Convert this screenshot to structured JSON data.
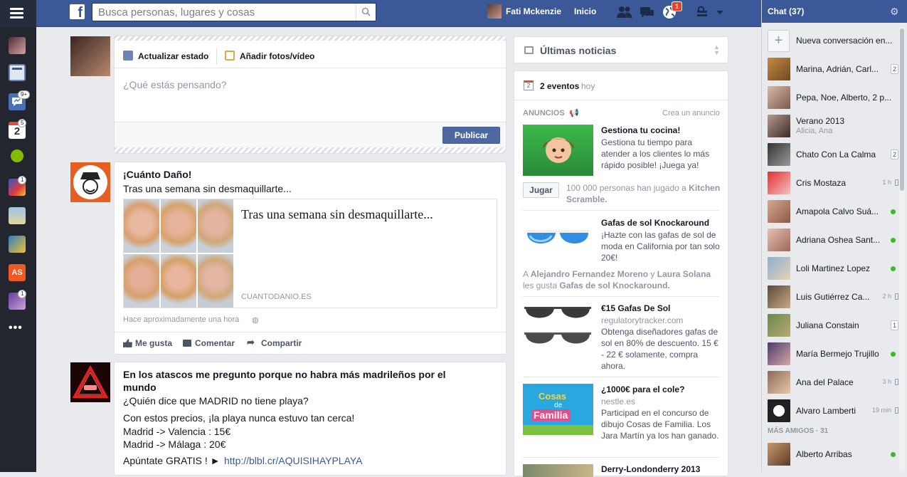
{
  "header": {
    "search_placeholder": "Busca personas, lugares y cosas",
    "user_name": "Fati Mckenzie",
    "home_label": "Inicio",
    "notifications_count": "1"
  },
  "left_rail": {
    "badges": [
      "9+",
      "5",
      "1",
      "1"
    ],
    "calendar_day": "2"
  },
  "composer": {
    "tab_status": "Actualizar estado",
    "tab_photo": "Añadir fotos/vídeo",
    "placeholder": "¿Qué estás pensando?",
    "publish_label": "Publicar"
  },
  "post1": {
    "title": "¡Cuánto Daño!",
    "text": "Tras una semana sin desmaquillarte...",
    "link_title": "Tras una semana sin desmaquillarte...",
    "link_domain": "CUANTODANIO.ES",
    "timestamp": "Hace aproximadamente una hora",
    "like": "Me gusta",
    "comment": "Comentar",
    "share": "Compartir"
  },
  "post2": {
    "title": "En los atascos me pregunto porque no habra más madrileños por el mundo",
    "line1": "¿Quién dice que MADRID no tiene playa?",
    "line2": "Con estos precios, ¡la playa nunca estuvo tan cerca!",
    "line3": "Madrid -> Valencia : 15€",
    "line4": "Madrid -> Málaga : 20€",
    "line5": "Apúntate GRATIS ! ►",
    "link": "http://blbl.cr/AQUISIHAYPLAYA"
  },
  "news": {
    "title": "Últimas noticias"
  },
  "events": {
    "icon_day": "2",
    "label": "2 eventos",
    "when": "hoy"
  },
  "ads": {
    "section": "ANUNCIOS",
    "create": "Crea un anuncio",
    "items": [
      {
        "title": "Gestiona tu cocina!",
        "text": "Gestiona tu tiempo para atender a los clientes lo más rápido posible! ¡Juega ya!",
        "button": "Jugar",
        "social_count": "100 000 personas han jugado a",
        "social_app": "Kitchen Scramble."
      },
      {
        "title": "Gafas de sol Knockaround",
        "text": "¡Hazte con las gafas de sol de moda en California por tan solo 20€!",
        "social_a": "A",
        "social_p1": "Alejandro Fernandez Moreno",
        "social_y": "y",
        "social_p2": "Laura Solana",
        "social_likes": "les gusta",
        "social_page": "Gafas de sol Knockaround."
      },
      {
        "title": "€15 Gafas De Sol",
        "domain": "regulatorytracker.com",
        "text": "Obtenga diseñadores gafas de sol en 80% de descuento. 15 € - 22 € solamente, compra ahora."
      },
      {
        "title": "¿1000€ para el cole?",
        "domain": "nestle.es",
        "text": "Participad en el concurso de dibujo Cosas de Familia. Los Jara Martín ya los han ganado.",
        "img_text1": "Cosas",
        "img_text2": "de",
        "img_text3": "Familia"
      },
      {
        "title": "Derry-Londonderry 2013"
      }
    ]
  },
  "chat": {
    "header": "Chat (37)",
    "new_conversation": "Nueva conversación en...",
    "more_friends": "MÁS AMIGOS · 31",
    "rows": [
      {
        "name": "Marina, Adrián, Carl...",
        "count": "2"
      },
      {
        "name": "Pepa, Noe, Alberto, 2 p..."
      },
      {
        "name": "Verano 2013",
        "sub": "Alicia, Ana"
      },
      {
        "name": "Chato Con La Calma",
        "count": "2"
      },
      {
        "name": "Cris Mostaza",
        "time": "1 h"
      },
      {
        "name": "Amapola Calvo Suá..."
      },
      {
        "name": "Adriana Oshea Sant..."
      },
      {
        "name": "Loli Martinez Lopez"
      },
      {
        "name": "Luis Gutiérrez Ca...",
        "time": "2 h"
      },
      {
        "name": "Juliana Constain",
        "count": "1"
      },
      {
        "name": "María Bermejo Trujillo"
      },
      {
        "name": "Ana del Palace",
        "time": "3 h"
      },
      {
        "name": "Alvaro Lamberti",
        "time": "19 min"
      },
      {
        "name": "Alberto Arribas"
      }
    ]
  }
}
